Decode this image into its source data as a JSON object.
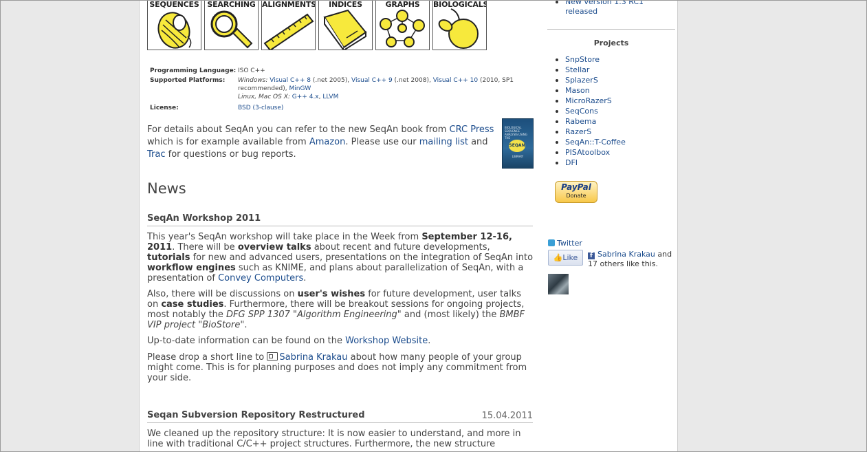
{
  "features": [
    {
      "label": "SEQUENCES",
      "icon": "thread-spool-icon"
    },
    {
      "label": "SEARCHING",
      "icon": "magnifier-icon"
    },
    {
      "label": "ALIGNMENTS",
      "icon": "ruler-icon"
    },
    {
      "label": "INDICES",
      "icon": "book-icon"
    },
    {
      "label": "GRAPHS",
      "icon": "graph-icon"
    },
    {
      "label": "BIOLOGICALS",
      "icon": "fruit-icon"
    }
  ],
  "info": {
    "language_key": "Programming Language:",
    "language_val": "ISO C++",
    "platforms_key": "Supported Platforms:",
    "win_prefix": "Windows:",
    "vc8": "Visual C++ 8",
    "vc8_note": " (.net 2005), ",
    "vc9": "Visual C++ 9",
    "vc9_note": " (.net 2008), ",
    "vc10": "Visual C++ 10",
    "vc10_note": " (2010, SP1 recommended), ",
    "mingw": "MinGW",
    "unix_prefix": "Linux, Mac OS X:",
    "gcc": "G++ 4.x",
    "llvm": "LLVM",
    "license_key": "License:",
    "license_val": "BSD (3-clause)"
  },
  "intro": {
    "t1": "For details about SeqAn you can refer to the new SeqAn book from ",
    "crc": "CRC Press",
    "t2": " which is for example available from ",
    "amazon": "Amazon",
    "t3": ". Please use our ",
    "mailing": "mailing list",
    "t4": " and ",
    "trac": "Trac",
    "t5": " for questions or bug reports."
  },
  "book": {
    "text": "BIOLOGICAL SEQUENCE ANALYSIS USING THE",
    "logo": "SEQAN",
    "sub": "LIBRARY"
  },
  "news_heading": "News",
  "post1": {
    "title": "SeqAn Workshop 2011",
    "p1": {
      "a": "This year's SeqAn workshop will take place in the Week from ",
      "b": "September 12-16, 2011",
      "c": ". There will be ",
      "d": "overview talks",
      "e": " about recent and future developments, ",
      "f": "tutorials",
      "g": " for new and advanced users, presentations on the integration of SeqAn into ",
      "h": "workflow engines",
      "i": " such as KNIME, and plans about parallelization of SeqAn, with a presentation of ",
      "link": "Convey Computers",
      "j": "."
    },
    "p2": {
      "a": "Also, there will be discussions on ",
      "b": "user's wishes",
      "c": " for future development, user talks on ",
      "d": "case studies",
      "e": ". Furthermore, there will be breakout sessions for ongoing projects, most notably the ",
      "f": "DFG SPP 1307 \"Algorithm Engineering\"",
      "g": " and (most likely) the ",
      "h": "BMBF VIP project \"BioStore\"",
      "i": "."
    },
    "p3": {
      "a": "Up-to-date information can be found on the ",
      "link": "Workshop Website",
      "b": "."
    },
    "p4": {
      "a": "Please drop a short line to ",
      "link": "Sabrina Krakau",
      "b": " about how many people of your group might come. This is for planning purposes and does not imply any commitment from your side."
    }
  },
  "post2": {
    "title": "Seqan Subversion Repository Restructured",
    "date": "15.04.2011",
    "p1": "We cleaned up the repository structure: It is now easier to understand, and more in line with traditional C/C++ project structures. Furthermore, the new structure"
  },
  "sidebar": {
    "news_item": "New version 1.3 RC1 released",
    "projects_heading": "Projects",
    "projects": [
      "SnpStore",
      "Stellar",
      "SplazerS",
      "Mason",
      "MicroRazerS",
      "SeqCons",
      "Rabema",
      "RazerS",
      "SeqAn::T-Coffee",
      "PISAtoolbox",
      "DFI"
    ],
    "paypal": "PayPal",
    "donate": "Donate",
    "twitter": "Twitter",
    "like": "Like",
    "fb_name": "Sabrina Krakau",
    "fb_rest": " and 17 others like this."
  }
}
